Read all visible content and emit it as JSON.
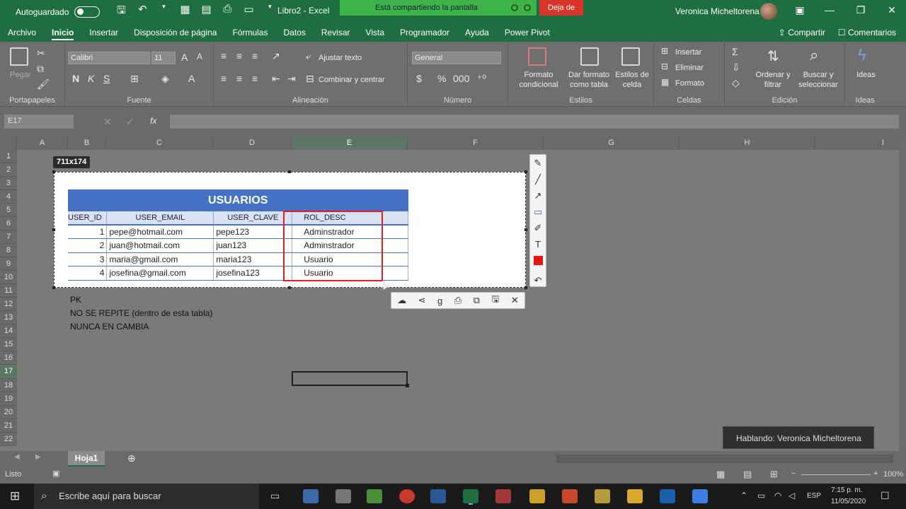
{
  "titlebar": {
    "autosave_label": "Autoguardado",
    "doc_title": "Libro2  -  Excel",
    "share_banner": "Está compartiendo la pantalla",
    "stop_share": "Deja de",
    "user_name": "Veronica Micheltorena"
  },
  "tabs": [
    "Archivo",
    "Inicio",
    "Insertar",
    "Disposición de página",
    "Fórmulas",
    "Datos",
    "Revisar",
    "Vista",
    "Programador",
    "Ayuda",
    "Power Pivot"
  ],
  "tabs_right": {
    "share": "Compartir",
    "comments": "Comentarios"
  },
  "ribbon": {
    "clipboard": {
      "paste": "Pegar",
      "label": "Portapapeles"
    },
    "font": {
      "name": "Calibri",
      "size": "11",
      "bold": "N",
      "italic": "K",
      "underline": "S",
      "label": "Fuente"
    },
    "alignment": {
      "wrap": "Ajustar texto",
      "merge": "Combinar y centrar",
      "label": "Alineación"
    },
    "number": {
      "format": "General",
      "label": "Número"
    },
    "styles": {
      "conditional": "Formato condicional",
      "as_table": "Dar formato como tabla",
      "cell_styles": "Estilos de celda",
      "label": "Estilos"
    },
    "cells": {
      "insert": "Insertar",
      "delete": "Eliminar",
      "format": "Formato",
      "label": "Celdas"
    },
    "editing": {
      "sort": "Ordenar y filtrar",
      "find": "Buscar y seleccionar",
      "label": "Edición"
    },
    "ideas": {
      "button": "Ideas",
      "label": "Ideas"
    }
  },
  "formula_bar": {
    "name_box": "E17",
    "fx": "fx",
    "content": ""
  },
  "columns": [
    {
      "label": "A",
      "selected": false
    },
    {
      "label": "B",
      "selected": false
    },
    {
      "label": "C",
      "selected": false
    },
    {
      "label": "D",
      "selected": false
    },
    {
      "label": "E",
      "selected": true
    },
    {
      "label": "F",
      "selected": false
    },
    {
      "label": "G",
      "selected": false
    },
    {
      "label": "H",
      "selected": false
    },
    {
      "label": "I",
      "selected": false
    }
  ],
  "rows": [
    "1",
    "2",
    "3",
    "4",
    "5",
    "6",
    "7",
    "8",
    "9",
    "10",
    "11",
    "12",
    "13",
    "14",
    "15",
    "16",
    "17",
    "18",
    "19",
    "20",
    "21",
    "22"
  ],
  "selected_row": "17",
  "notes": [
    "PK",
    "NO SE REPITE (dentro de esta tabla)",
    "NUNCA EN CAMBIA"
  ],
  "snip": {
    "size_tag": "711x174",
    "table_title": "USUARIOS",
    "headers": [
      "USER_ID",
      "USER_EMAIL",
      "USER_CLAVE",
      "ROL_DESC"
    ],
    "rows": [
      [
        "1",
        "pepe@hotmail.com",
        "pepe123",
        "Adminstrador"
      ],
      [
        "2",
        "juan@hotmail.com",
        "juan123",
        "Adminstrador"
      ],
      [
        "3",
        "maria@gmail.com",
        "maria123",
        "Usuario"
      ],
      [
        "4",
        "josefina@gmail.com",
        "josefina123",
        "Usuario"
      ]
    ]
  },
  "sheet": {
    "tab": "Hoja1"
  },
  "status": {
    "ready": "Listo",
    "zoom": "100%"
  },
  "toast": "Hablando: Veronica Micheltorena",
  "taskbar": {
    "search_placeholder": "Escribe aquí para buscar",
    "lang": "ESP",
    "time": "7:15 p. m.",
    "date": "11/05/2020"
  }
}
